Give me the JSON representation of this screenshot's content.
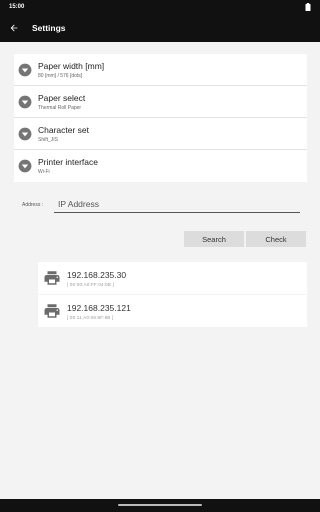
{
  "status_bar": {
    "time": "15:00"
  },
  "app_bar": {
    "title": "Settings",
    "back_icon": "arrow-back-icon"
  },
  "settings": [
    {
      "title": "Paper width [mm]",
      "value": "80 [mm] / 576 [dots]",
      "icon": "dropdown-circle-icon"
    },
    {
      "title": "Paper select",
      "value": "Thermal Roll Paper",
      "icon": "dropdown-circle-icon"
    },
    {
      "title": "Character set",
      "value": "Shift_JIS",
      "icon": "dropdown-circle-icon"
    },
    {
      "title": "Printer interface",
      "value": "Wi-Fi",
      "icon": "dropdown-circle-icon"
    }
  ],
  "address": {
    "label": "Address :",
    "placeholder": "IP Address",
    "value": ""
  },
  "buttons": {
    "search": "Search",
    "check": "Check"
  },
  "results": [
    {
      "ip": "192.168.235.30",
      "mac": "[ 00:00:A0:FF:04:0B ]",
      "icon": "printer-icon"
    },
    {
      "ip": "192.168.235.121",
      "mac": "[ 00:11:A0:08:8F:8B ]",
      "icon": "printer-icon"
    }
  ],
  "colors": {
    "bar": "#111111",
    "background": "#f3f3f3",
    "icon": "#757575",
    "button": "#dcdcdc"
  }
}
